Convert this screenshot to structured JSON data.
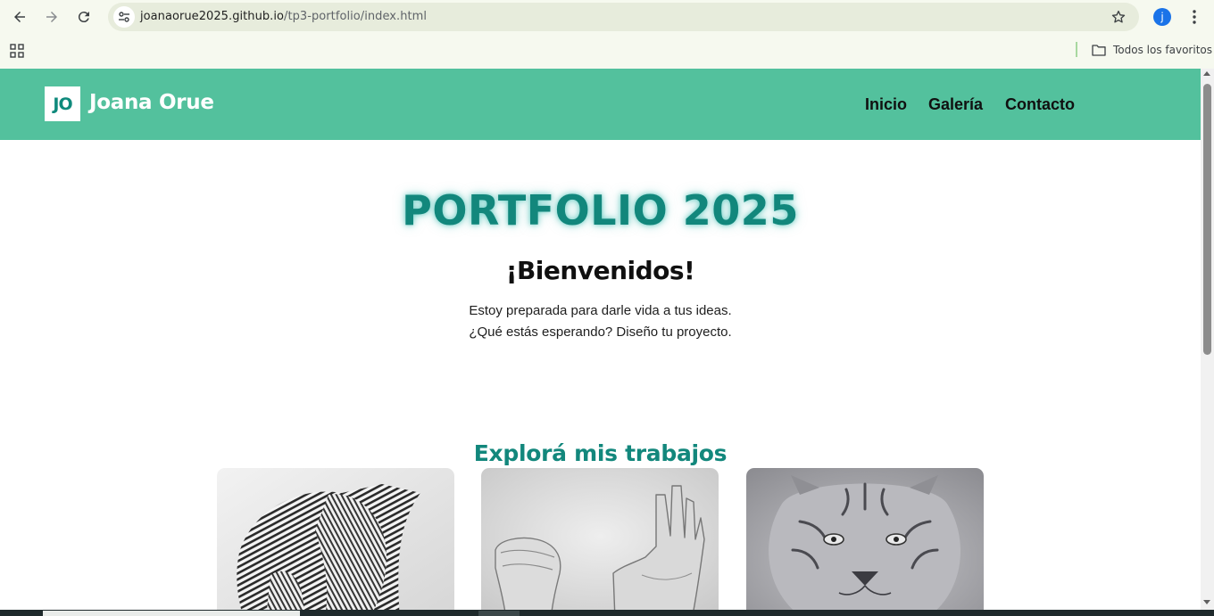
{
  "browser": {
    "url_host": "joanaorue2025.github.io",
    "url_path": "/tp3-portfolio/index.html",
    "profile_initial": "j",
    "bookmarks_folder_label": "Todos los favoritos"
  },
  "site": {
    "logo_initials": "JO",
    "brand_name": "Joana Orue",
    "nav": [
      {
        "label": "Inicio"
      },
      {
        "label": "Galería"
      },
      {
        "label": "Contacto"
      }
    ]
  },
  "hero": {
    "title": "PORTFOLIO 2025",
    "welcome": "¡Bienvenidos!",
    "intro_line_1": "Estoy preparada para darle vida a tus ideas.",
    "intro_line_2": "¿Qué estás esperando? Diseño tu proyecto."
  },
  "gallery": {
    "title": "Explorá mis trabajos",
    "items": [
      {
        "subject": "elephant-engraving"
      },
      {
        "subject": "hands-drawing"
      },
      {
        "subject": "tiger-drawing"
      }
    ]
  },
  "colors": {
    "header_bg": "#53c19d",
    "accent_teal": "#12877c",
    "browser_chrome": "#f6f9ef",
    "omnibox": "#e7ecdc"
  }
}
